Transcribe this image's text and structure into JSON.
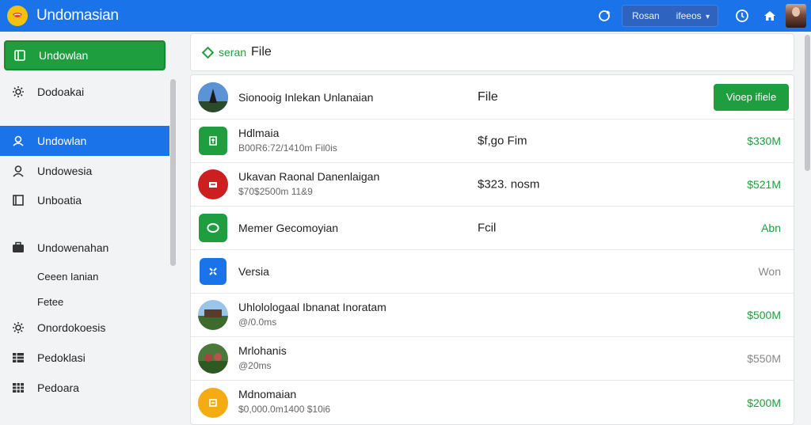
{
  "app": {
    "title": "Undomasian"
  },
  "topbar": {
    "pill_label": "Rosan",
    "pill_value": "ifeeos"
  },
  "sidebar": {
    "items": [
      {
        "label": "Undowlan",
        "icon": "book-icon"
      },
      {
        "label": "Dodoakai",
        "icon": "gear-icon"
      },
      {
        "label": "Undowlan",
        "icon": "user-icon"
      },
      {
        "label": "Undowesia",
        "icon": "person-icon"
      },
      {
        "label": "Unboatia",
        "icon": "square-icon"
      },
      {
        "label": "Undowenahan",
        "icon": "briefcase-icon"
      }
    ],
    "subitems": [
      "Ceeen Ianian",
      "Fetee"
    ],
    "items2": [
      {
        "label": "Onordokoesis",
        "icon": "gear-icon"
      },
      {
        "label": "Pedoklasi",
        "icon": "grid-icon"
      },
      {
        "label": "Pedoara",
        "icon": "grid-icon"
      }
    ]
  },
  "main": {
    "search": {
      "label": "seran",
      "file": "File"
    },
    "header": {
      "name": "Sionooig Inlekan Unlanaian",
      "mid": "File",
      "button": "Vioep ifiele"
    },
    "rows": [
      {
        "name": "Hdlmaia",
        "sub": "B00R6:72/1410m Fil0is",
        "mid": "$f,go Fim",
        "amt": "$330M",
        "amt_color": "green",
        "avatar": "green-square"
      },
      {
        "name": "Ukavan Raonal Danenlaigan",
        "sub": "$70$2500m 11&9",
        "mid": "$323. nosm",
        "amt": "$521M",
        "amt_color": "green",
        "avatar": "red-circle"
      },
      {
        "name": "Memer Gecomoyian",
        "sub": "",
        "mid": "Fcil",
        "amt": "Abn",
        "amt_color": "green",
        "avatar": "green-ring"
      },
      {
        "name": "Versia",
        "sub": "",
        "mid": "",
        "amt": "Won",
        "amt_color": "gray",
        "avatar": "blue-square"
      },
      {
        "name": "Uhlolologaal Ibnanat Inoratam",
        "sub": "@/0.0ms",
        "mid": "",
        "amt": "$500M",
        "amt_color": "green",
        "avatar": "photo-1"
      },
      {
        "name": "Mrlohanis",
        "sub": "@20ms",
        "mid": "",
        "amt": "$550M",
        "amt_color": "gray",
        "avatar": "photo-2"
      },
      {
        "name": "Mdnomaian",
        "sub": "$0,000.0m1400 $10i6",
        "mid": "",
        "amt": "$200M",
        "amt_color": "green",
        "avatar": "yellow-circle"
      }
    ]
  }
}
